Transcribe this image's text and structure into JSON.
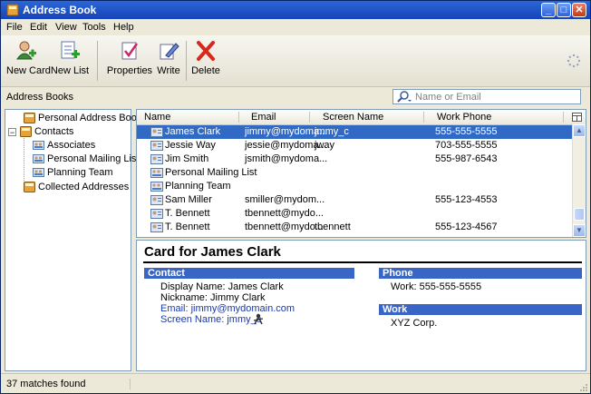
{
  "window": {
    "title": "Address Book",
    "min_icon": "minimize-icon",
    "max_icon": "maximize-icon",
    "close_icon": "close-icon"
  },
  "menu": {
    "file": "File",
    "edit": "Edit",
    "view": "View",
    "tools": "Tools",
    "help": "Help"
  },
  "toolbar": {
    "new_card": "New Card",
    "new_list": "New List",
    "properties": "Properties",
    "write": "Write",
    "delete": "Delete"
  },
  "search": {
    "label": "Address Books",
    "placeholder": "Name or Email"
  },
  "tree": {
    "items": [
      {
        "label": "Personal Address Book",
        "icon": "address-book-icon"
      },
      {
        "label": "Contacts",
        "icon": "address-book-icon",
        "expander": "−"
      },
      {
        "label": "Associates",
        "icon": "mailing-list-icon"
      },
      {
        "label": "Personal Mailing List",
        "icon": "mailing-list-icon"
      },
      {
        "label": "Planning Team",
        "icon": "mailing-list-icon"
      },
      {
        "label": "Collected Addresses",
        "icon": "address-book-icon"
      }
    ]
  },
  "list": {
    "columns": {
      "name": "Name",
      "email": "Email",
      "screen": "Screen Name",
      "phone": "Work Phone"
    },
    "rows": [
      {
        "name": "James Clark",
        "email": "jimmy@mydoma...",
        "screen": "jmmy_c",
        "phone": "555-555-5555"
      },
      {
        "name": "Jessie Way",
        "email": "jessie@mydoma...",
        "screen": "jway",
        "phone": "703-555-5555"
      },
      {
        "name": "Jim Smith",
        "email": "jsmith@mydoma...",
        "screen": "",
        "phone": "555-987-6543"
      },
      {
        "name": "Personal Mailing List",
        "email": "",
        "screen": "",
        "phone": ""
      },
      {
        "name": "Planning Team",
        "email": "",
        "screen": "",
        "phone": ""
      },
      {
        "name": "Sam Miller",
        "email": "smiller@mydom...",
        "screen": "",
        "phone": "555-123-4553"
      },
      {
        "name": "T. Bennett",
        "email": "tbennett@mydo...",
        "screen": "",
        "phone": ""
      },
      {
        "name": "T. Bennett",
        "email": "tbennett@mydo...",
        "screen": "tbennett",
        "phone": "555-123-4567"
      }
    ],
    "column_picker_icon": "column-picker-icon"
  },
  "card": {
    "title": "Card for James Clark",
    "contact_heading": "Contact",
    "display_name": "Display Name: James Clark",
    "nickname": "Nickname: Jimmy Clark",
    "email": "Email: jimmy@mydomain.com",
    "screen_name": "Screen Name: jmmy_c",
    "phone_heading": "Phone",
    "work_phone": "Work: 555-555-5555",
    "work_heading": "Work",
    "company": "XYZ Corp."
  },
  "status": {
    "text": "37 matches found"
  },
  "colors": {
    "title_bar": "#1543b8",
    "selection": "#316ac5",
    "section_header": "#3965c6",
    "link": "#1a3aa8"
  }
}
